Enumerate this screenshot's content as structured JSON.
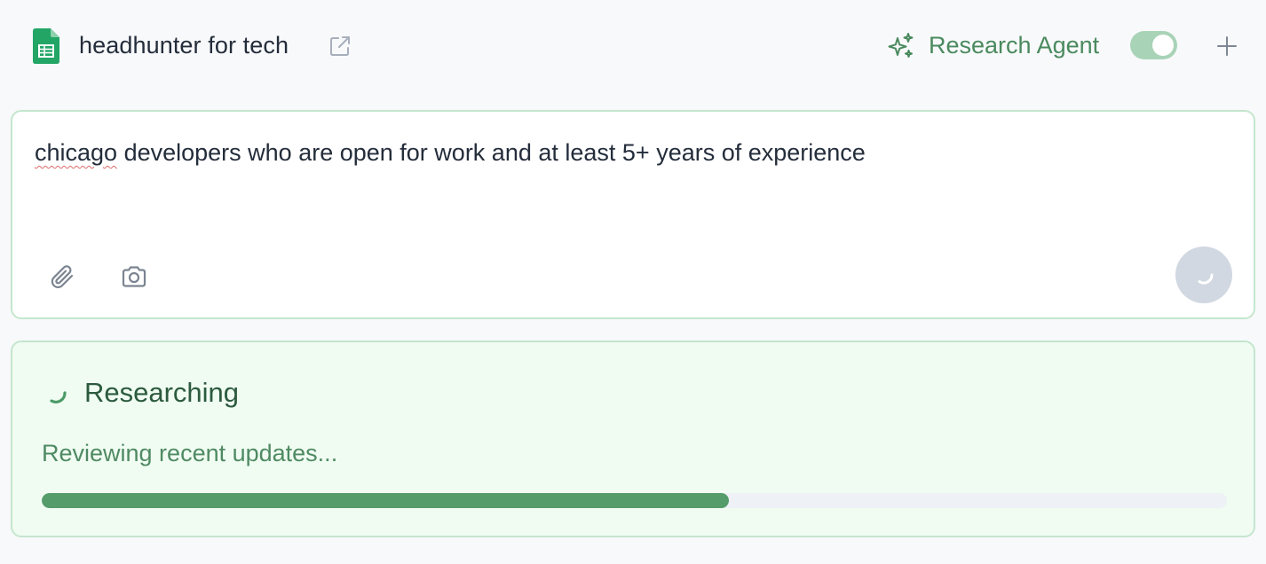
{
  "header": {
    "doc_title": "headhunter for tech",
    "doc_icon": "spreadsheet-icon",
    "open_external_icon": "external-link-icon",
    "agent_icon": "sparkles-icon",
    "agent_label": "Research Agent",
    "agent_toggle_on": true,
    "add_icon": "plus-icon"
  },
  "query": {
    "text_first_word": "chicago",
    "text_rest": " developers who are open for work and at least 5+ years of experience",
    "attach_icon": "paperclip-icon",
    "screenshot_icon": "camera-icon",
    "submit_icon": "loading-spinner-icon"
  },
  "research": {
    "title": "Researching",
    "status": "Reviewing recent updates...",
    "progress": 0.58
  },
  "colors": {
    "accent": "#4a8a5e",
    "progress_fill": "#559c6b",
    "panel_bg": "#f0fcf2",
    "border": "#c4e6cd"
  }
}
